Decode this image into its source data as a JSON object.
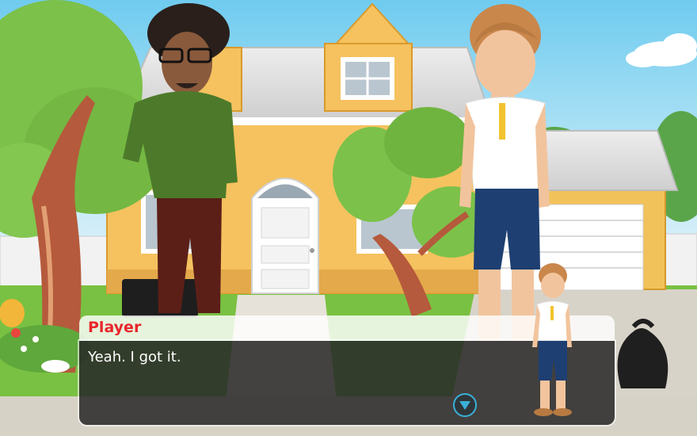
{
  "dialog": {
    "speaker": "Player",
    "line": "Yeah. I got it."
  },
  "icons": {
    "next": "chevron-down-icon"
  },
  "colors": {
    "speaker_name": "#e8262b",
    "next_button": "#3bb0d9"
  }
}
